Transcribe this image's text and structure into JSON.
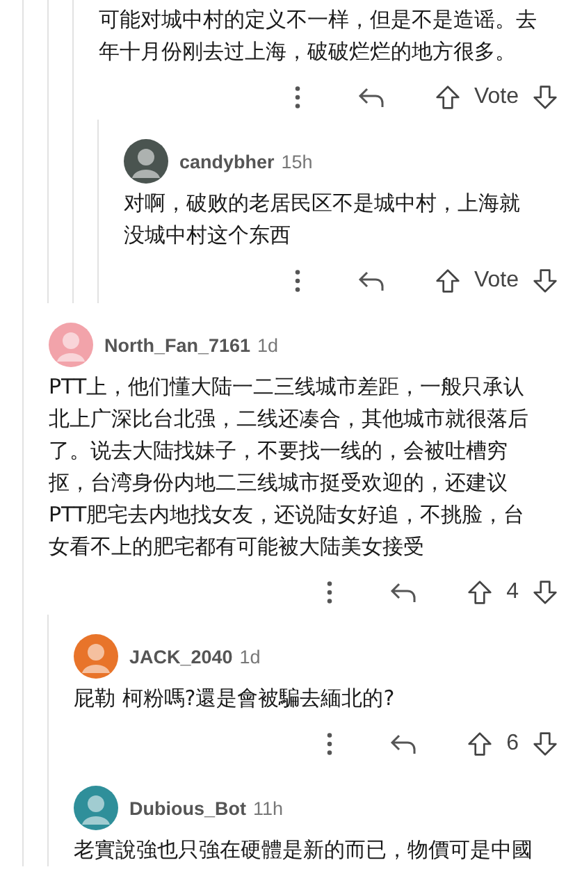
{
  "comments": [
    {
      "children": [
        {
          "children": [
            {
              "body": "可能对城中村的定义不一样，但是不是造谣。去年十月份刚去过上海，破破烂烂的地方很多。",
              "score": "Vote",
              "children": [
                {
                  "author": "candybher",
                  "time": "15h",
                  "color": "#4a5450",
                  "body": "对啊，破败的老居民区不是城中村，上海就没城中村这个东西",
                  "score": "Vote"
                }
              ]
            }
          ]
        }
      ]
    },
    {
      "author": "North_Fan_7161",
      "time": "1d",
      "color": "#f2a3aa",
      "body": "PTT上，他们懂大陆一二三线城市差距，一般只承认北上广深比台北强，二线还凑合，其他城市就很落后了。说去大陆找妹子，不要找一线的，会被吐槽穷抠，台湾身份内地二三线城市挺受欢迎的，还建议PTT肥宅去内地找女友，还说陆女好追，不挑脸，台女看不上的肥宅都有可能被大陆美女接受",
      "score": "4",
      "children": [
        {
          "author": "JACK_2040",
          "time": "1d",
          "color": "#e8742a",
          "body": "屁勒 柯粉嗎?還是會被騙去緬北的?",
          "score": "6"
        },
        {
          "author": "Dubious_Bot",
          "time": "11h",
          "color": "#2f8f9a",
          "body": "老實說強也只強在硬體是新的而已，物價可是中國"
        }
      ]
    }
  ]
}
